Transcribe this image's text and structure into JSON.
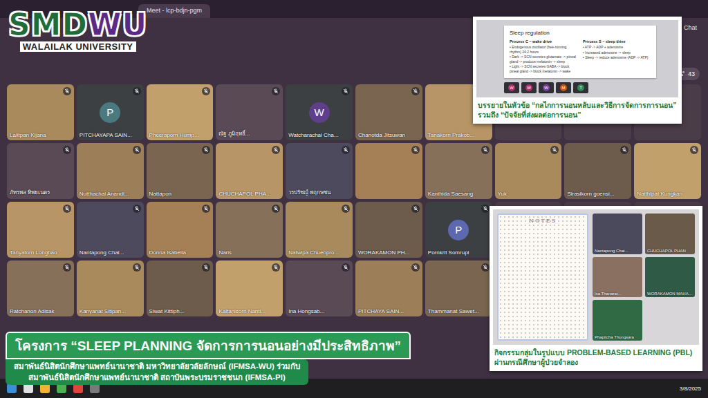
{
  "browser": {
    "tab_title": "Meet - lcp-bdjn-pgm"
  },
  "header": {
    "chat_label": "Chat",
    "participant_count": "43"
  },
  "logo": {
    "part1": "SMD",
    "part2": "WU",
    "subtitle": "WALAILAK UNIVERSITY"
  },
  "grid": {
    "rows": [
      {
        "tiles": [
          {
            "kind": "video",
            "name": "Lalitpan Kijana"
          },
          {
            "kind": "avatar",
            "name": "PITCHAYAPA SAIN...",
            "letter": "P",
            "color": "#4a7a80"
          },
          {
            "kind": "video",
            "name": "Pheeraporn Hump..."
          },
          {
            "kind": "video",
            "name": "ณัฐ ภูมิฤทธิ์..."
          },
          {
            "kind": "avatar",
            "name": "Watcharachai Cha...",
            "letter": "W",
            "color": "#5e3f8c"
          },
          {
            "kind": "video",
            "name": "Chanotda Jitsuwan"
          },
          {
            "kind": "video",
            "name": "Tanakorn Prakob..."
          }
        ]
      },
      {
        "tiles": [
          {
            "kind": "video",
            "name": "ภัทรพล ทิพยเนตร"
          },
          {
            "kind": "video",
            "name": "Nutthachai Anandi..."
          },
          {
            "kind": "video",
            "name": "Nattapon"
          },
          {
            "kind": "video",
            "name": "CHUCHAPOL PHA..."
          },
          {
            "kind": "video",
            "name": "วรปรัชญ์ พฤกษชน"
          },
          {
            "kind": "video"
          },
          {
            "kind": "video",
            "name": "Kanthida Saesang"
          },
          {
            "kind": "video",
            "name": "Yuk"
          },
          {
            "kind": "video",
            "name": "Sirasikorn goensi..."
          },
          {
            "kind": "video",
            "name": "Natthipat Kungkan"
          }
        ]
      },
      {
        "tiles": [
          {
            "kind": "video",
            "name": "Tanyatorn Longbao"
          },
          {
            "kind": "video",
            "name": "Nantapong Chai..."
          },
          {
            "kind": "video",
            "name": "Donna Isabella"
          },
          {
            "kind": "video",
            "name": "Naris"
          },
          {
            "kind": "video",
            "name": "Natwipa Chuenpro..."
          },
          {
            "kind": "video",
            "name": "WORAKAMON PH..."
          },
          {
            "kind": "avatar",
            "name": "Pornkrit Somrupi",
            "letter": "P",
            "color": "#5c68b0"
          }
        ]
      },
      {
        "tiles": [
          {
            "kind": "video",
            "name": "Ratchanon Adisak"
          },
          {
            "kind": "video",
            "name": "Kanyanat Sitipan..."
          },
          {
            "kind": "video",
            "name": "Siwat Kittiph..."
          },
          {
            "kind": "video",
            "name": "Kaltanisorn Nanti..."
          },
          {
            "kind": "video",
            "name": "Ina Hongsab..."
          },
          {
            "kind": "video",
            "name": "PITCHAYA SAIN..."
          },
          {
            "kind": "video",
            "name": "Thammanat Sawet..."
          }
        ]
      }
    ]
  },
  "inset1": {
    "slide": {
      "title": "Sleep regulation",
      "left": {
        "heading": "Process C – wake drive",
        "items": [
          "• Endogenous oscillator (free-running rhythm) 24.2 hours",
          "• Dark -> SCN secretes glutamate -> pineal gland -> produce melatonin -> sleep",
          "• Light -> SCN secretes GABA -> block pineal gland -> block melatonin -> wake"
        ]
      },
      "right": {
        "heading": "Process S – sleep drive",
        "items": [
          "• ATP -> ADP + adenosine",
          "• Increased adenosine -> sleep",
          "• Sleep -> reduce adenosine (ADP -> ATP)"
        ]
      }
    },
    "tiles": [
      {
        "letter": "W",
        "color": "#b0306a"
      },
      {
        "letter": "W",
        "color": "#b0306a"
      },
      {
        "letter": "W",
        "color": "#7b3fa0"
      },
      {
        "letter": "M",
        "color": "#d35400"
      },
      {
        "letter": "T",
        "color": "#2e8b57"
      }
    ],
    "caption": "บรรยายในหัวข้อ “กลไกการนอนหลับและวิธีการจัดการการนอน” รวมถึง “ปัจจัยที่ส่งผลต่อการนอน”"
  },
  "inset2": {
    "notes_title": "NOTES",
    "tiles": [
      {
        "name": "Nantapong Chai..."
      },
      {
        "name": "CHUCHAPOL PHAN"
      },
      {
        "name": "Isa Thanarat..."
      },
      {
        "name": "WORAKAMON MAHA..."
      },
      {
        "name": "Phapitcha Thongsara"
      }
    ],
    "caption": "กิจกรรมกลุ่มในรูปแบบ PROBLEM-BASED LEARNING (PBL) ผ่านกรณีศึกษาผู้ป่วยจำลอง"
  },
  "banner": {
    "title": "โครงการ “SLEEP PLANNING จัดการการนอนอย่างมีประสิทธิภาพ”",
    "lines": [
      "สมาพันธ์นิสิตนักศึกษาแพทย์นานาชาติ มหาวิทยาลัยวลัยลักษณ์ (IFMSA-WU) ร่วมกับ",
      "สมาพันธ์นิสิตนักศึกษาแพทย์นานาชาติ สถาบันพระบรมราชชนก (IFMSA-PI)"
    ]
  },
  "taskbar": {
    "date": "3/8/2025"
  }
}
